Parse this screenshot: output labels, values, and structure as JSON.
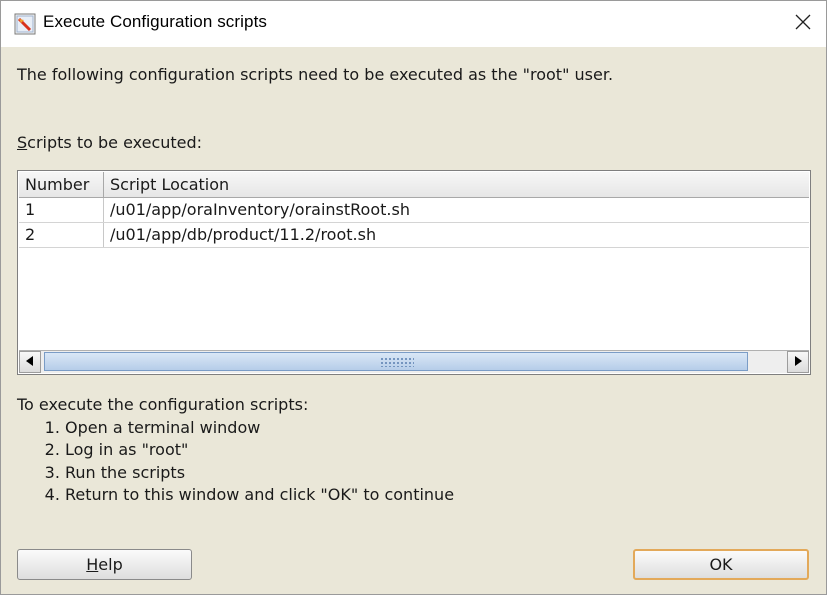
{
  "window": {
    "title": "Execute Configuration scripts"
  },
  "message": "The following configuration scripts need to be executed as the \"root\" user.",
  "scripts_label": {
    "mnemonic": "S",
    "rest": "cripts to be executed:"
  },
  "table": {
    "columns": [
      "Number",
      "Script Location"
    ],
    "rows": [
      {
        "number": "1",
        "location": "/u01/app/oraInventory/orainstRoot.sh"
      },
      {
        "number": "2",
        "location": "/u01/app/db/product/11.2/root.sh"
      }
    ]
  },
  "instructions": {
    "heading": "To execute the configuration scripts:",
    "steps": [
      "Open a terminal window",
      "Log in as \"root\"",
      "Run the scripts",
      "Return to this window and click \"OK\" to continue"
    ]
  },
  "buttons": {
    "help": {
      "mnemonic": "H",
      "rest": "elp"
    },
    "ok": "OK"
  },
  "icons": {
    "app": "oracle-installer-icon",
    "close": "close-icon",
    "scroll_left": "arrow-left-icon",
    "scroll_right": "arrow-right-icon"
  }
}
